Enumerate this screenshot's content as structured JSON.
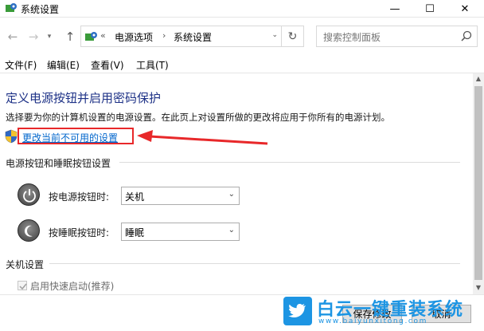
{
  "window": {
    "title": "系统设置",
    "minimize": "—",
    "maximize": "☐",
    "close": "✕"
  },
  "nav": {
    "back": "←",
    "forward": "→",
    "recent": "▾",
    "up": "↑",
    "breadcrumb_chevron": "«",
    "breadcrumb": [
      "电源选项",
      "系统设置"
    ],
    "separator": "›",
    "dropdown": "⌄",
    "refresh": "↻",
    "search_placeholder": "搜索控制面板"
  },
  "menubar": [
    "文件(F)",
    "编辑(E)",
    "查看(V)",
    "工具(T)"
  ],
  "content": {
    "heading": "定义电源按钮并启用密码保护",
    "description": "选择要为你的计算机设置的电源设置。在此页上对设置所做的更改将应用于你所有的电源计划。",
    "change_link": "更改当前不可用的设置",
    "power_section_title": "电源按钮和睡眠按钮设置",
    "power_button_label": "按电源按钮时:",
    "power_button_value": "关机",
    "sleep_button_label": "按睡眠按钮时:",
    "sleep_button_value": "睡眠",
    "shutdown_section_title": "关机设置",
    "fast_startup_label": "启用快速启动(推荐)",
    "fast_startup_checked": true
  },
  "footer": {
    "save": "保存修改",
    "cancel": "取消"
  },
  "watermark": {
    "brand": "白云一键重装系统",
    "url": "www.baiyunxitong.com"
  },
  "colors": {
    "heading": "#1e3287",
    "link": "#0066cc",
    "highlight": "#e8282a",
    "watermark": "#1d95e3"
  }
}
